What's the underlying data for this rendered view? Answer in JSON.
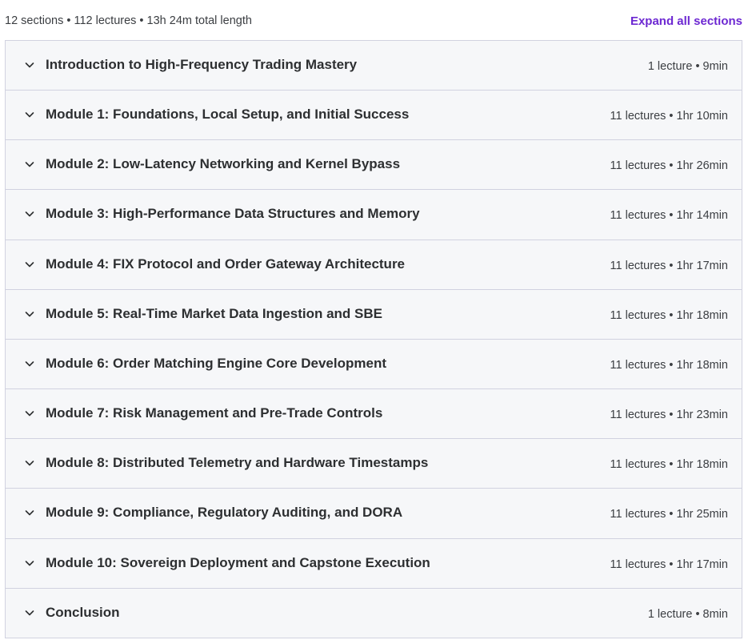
{
  "curriculum": {
    "summary": "12 sections • 112 lectures • 13h 24m total length",
    "expand_all_label": "Expand all sections",
    "sections": [
      {
        "title": "Introduction to High-Frequency Trading Mastery",
        "meta": "1 lecture • 9min"
      },
      {
        "title": "Module 1: Foundations, Local Setup, and Initial Success",
        "meta": "11 lectures • 1hr 10min"
      },
      {
        "title": "Module 2: Low-Latency Networking and Kernel Bypass",
        "meta": "11 lectures • 1hr 26min"
      },
      {
        "title": "Module 3: High-Performance Data Structures and Memory",
        "meta": "11 lectures • 1hr 14min"
      },
      {
        "title": "Module 4: FIX Protocol and Order Gateway Architecture",
        "meta": "11 lectures • 1hr 17min"
      },
      {
        "title": "Module 5: Real-Time Market Data Ingestion and SBE",
        "meta": "11 lectures • 1hr 18min"
      },
      {
        "title": "Module 6: Order Matching Engine Core Development",
        "meta": "11 lectures • 1hr 18min"
      },
      {
        "title": "Module 7: Risk Management and Pre-Trade Controls",
        "meta": "11 lectures • 1hr 23min"
      },
      {
        "title": "Module 8: Distributed Telemetry and Hardware Timestamps",
        "meta": "11 lectures • 1hr 18min"
      },
      {
        "title": "Module 9: Compliance, Regulatory Auditing, and DORA",
        "meta": "11 lectures • 1hr 25min"
      },
      {
        "title": "Module 10: Sovereign Deployment and Capstone Execution",
        "meta": "11 lectures • 1hr 17min"
      },
      {
        "title": "Conclusion",
        "meta": "1 lecture • 8min"
      }
    ],
    "section_icon": "chevron-down-icon",
    "colors": {
      "accent": "#6d28d2",
      "section_bg": "#f6f7f9",
      "border": "#d1d2e0",
      "text": "#2d2f31"
    }
  }
}
